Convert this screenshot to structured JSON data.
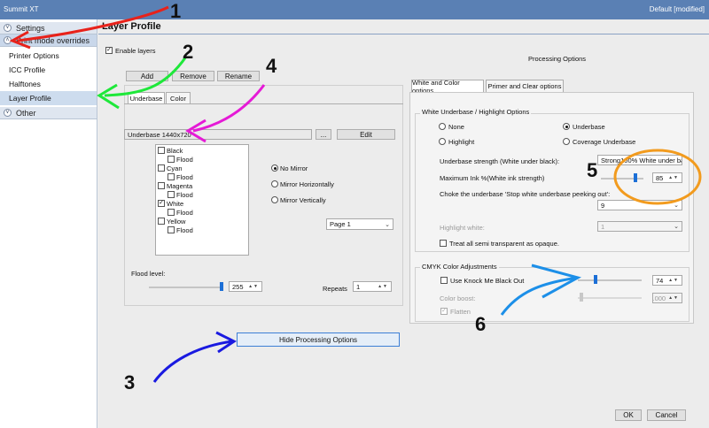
{
  "window": {
    "title": "Summit XT",
    "profile_status": "Default [modified]"
  },
  "sidebar": {
    "sections": [
      {
        "label": "Settings"
      },
      {
        "label": "Print mode overrides"
      }
    ],
    "items": [
      {
        "label": "Printer Options"
      },
      {
        "label": "ICC Profile"
      },
      {
        "label": "Halftones"
      },
      {
        "label": "Layer Profile"
      }
    ],
    "other": {
      "label": "Other"
    }
  },
  "main": {
    "title": "Layer Profile",
    "enable_layers": "Enable layers",
    "buttons": {
      "add": "Add",
      "remove": "Remove",
      "rename": "Rename"
    },
    "layer_tabs": [
      "Underbase",
      "Color"
    ],
    "layer_name": "Underbase 1440x720",
    "ellipsis": "...",
    "edit": "Edit",
    "channels": [
      "Black",
      "Flood",
      "Cyan",
      "Flood",
      "Magenta",
      "Flood",
      "White",
      "Flood",
      "Yellow",
      "Flood"
    ],
    "mirror": {
      "none": "No Mirror",
      "horizontal": "Mirror Horizontally",
      "vertical": "Mirror Vertically"
    },
    "page_select": "Page 1",
    "flood_level": {
      "label": "Flood level:",
      "value": "255",
      "fraction": 1.0
    },
    "repeats": {
      "label": "Repeats",
      "value": "1"
    },
    "hide_button": "Hide Processing Options",
    "processing_title": "Processing Options",
    "proc_tabs": [
      "White and Color options",
      "Primer and Clear options"
    ],
    "white_group": {
      "title": "White Underbase / Highlight Options",
      "options": [
        "None",
        "Underbase",
        "Highlight",
        "Coverage Underbase"
      ],
      "strength_label": "Underbase strength (White under black):",
      "strength_value": "Strong100% White under bas",
      "max_ink_label": "Maximum Ink %(White ink strength)",
      "max_ink_value": "85",
      "max_ink_fraction": 0.85,
      "choke_label": "Choke the underbase 'Stop white underbase peeking out':",
      "choke_value": "9",
      "highlight_label": "Highlight white:",
      "highlight_value": "1",
      "semi_label": "Treat all semi transparent as opaque."
    },
    "cmyk_group": {
      "title": "CMYK Color Adjustments",
      "knock_label": "Use Knock Me Black Out",
      "knock_value": "74",
      "knock_fraction": 0.3,
      "boost_label": "Color boost:",
      "boost_value": "1.000",
      "flatten_label": "Flatten"
    },
    "ok": "OK",
    "cancel": "Cancel"
  },
  "annotations": [
    "1",
    "2",
    "3",
    "4",
    "5",
    "6"
  ],
  "colors": {
    "red": "#e8221a",
    "green": "#1ee83a",
    "blue_dark": "#1a1ae0",
    "magenta": "#e51ad6",
    "orange": "#f29b1e",
    "blue_light": "#1c8fe8"
  }
}
